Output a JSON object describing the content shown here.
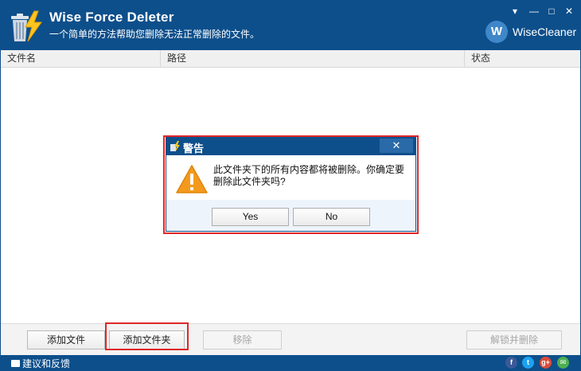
{
  "window": {
    "title": "Wise Force Deleter",
    "subtitle": "一个简单的方法帮助您删除无法正常删除的文件。",
    "brand": "WiseCleaner",
    "brand_logo_letter": "W",
    "controls": {
      "menu": "▾",
      "minimize": "—",
      "maximize": "□",
      "close": "✕"
    }
  },
  "table": {
    "columns": [
      "文件名",
      "路径",
      "状态"
    ]
  },
  "buttons": {
    "add_file": "添加文件",
    "add_folder": "添加文件夹",
    "remove": "移除",
    "unlock_delete": "解锁并删除"
  },
  "statusbar": {
    "feedback": "建议和反馈",
    "social": [
      {
        "name": "facebook-icon",
        "glyph": "f",
        "color": "#3b5998"
      },
      {
        "name": "twitter-icon",
        "glyph": "t",
        "color": "#1da1f2"
      },
      {
        "name": "google-plus-icon",
        "glyph": "g+",
        "color": "#dd4b39"
      },
      {
        "name": "email-icon",
        "glyph": "✉",
        "color": "#4caf50"
      }
    ]
  },
  "dialog": {
    "title": "警告",
    "close_glyph": "✕",
    "message": "此文件夹下的所有内容都将被删除。你确定要删除此文件夹吗?",
    "yes": "Yes",
    "no": "No"
  },
  "colors": {
    "accent": "#0d4f8b",
    "highlight": "#e02727",
    "warning": "#f39a1e"
  }
}
